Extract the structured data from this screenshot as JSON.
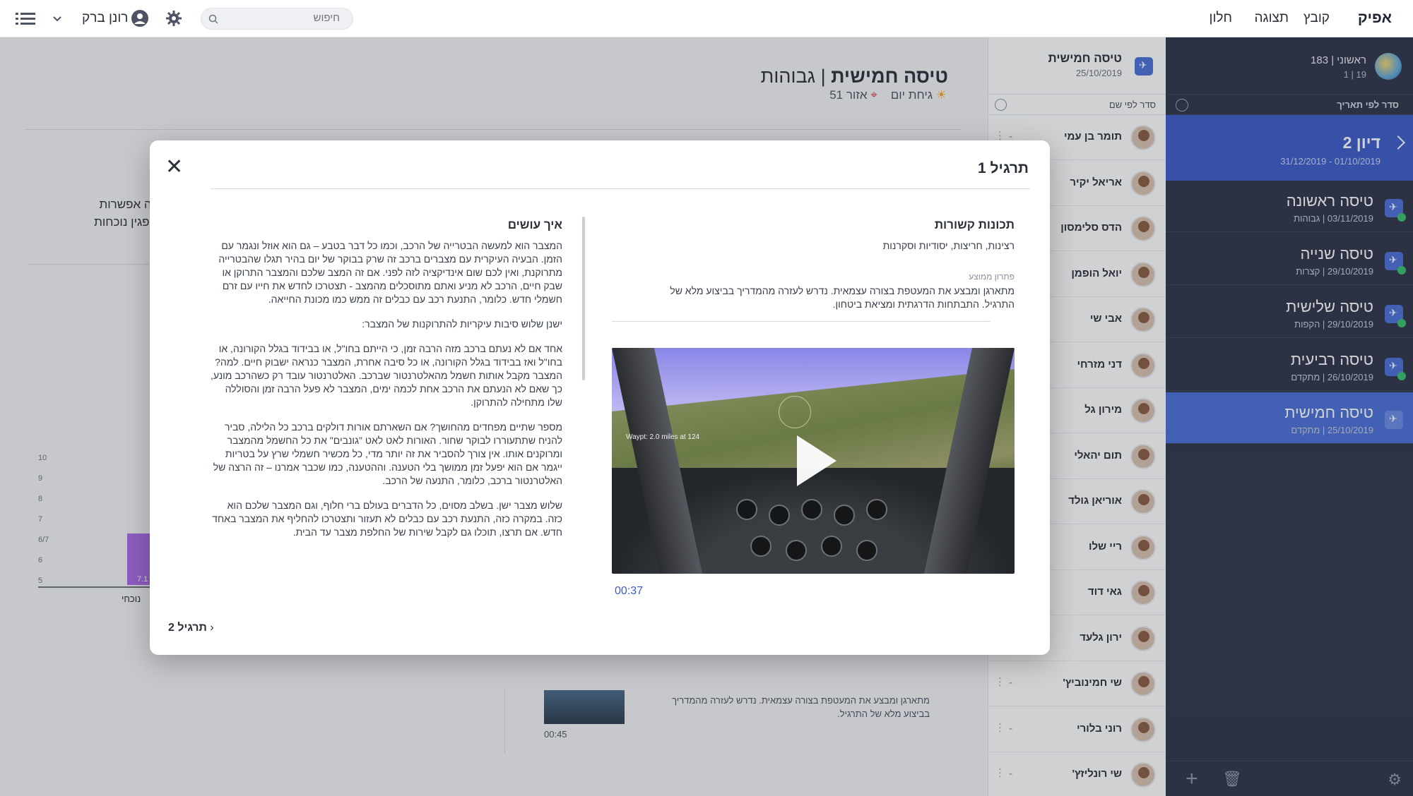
{
  "topbar": {
    "brand": "אפיק",
    "menu": [
      "קובץ",
      "תצוגה",
      "חלון"
    ],
    "search_placeholder": "חיפוש",
    "user_name": "רונן ברק"
  },
  "sidebar": {
    "header_title": "ראשוני | 183",
    "header_sub": "19 | 1",
    "sort_label": "סדר לפי תאריך",
    "group": {
      "title": "דיון 2",
      "dates": "01/10/2019 - 31/12/2019"
    },
    "items": [
      {
        "title": "טיסה ראשונה",
        "sub": "03/11/2019 | גבוהות",
        "check": true
      },
      {
        "title": "טיסה שנייה",
        "sub": "29/10/2019 | קצרות",
        "check": true
      },
      {
        "title": "טיסה שלישית",
        "sub": "29/10/2019 | הקפות",
        "check": true
      },
      {
        "title": "טיסה רביעית",
        "sub": "26/10/2019 | מתקדם",
        "check": true
      },
      {
        "title": "טיסה חמישית",
        "sub": "25/10/2019 | מתקדם",
        "check": false
      }
    ]
  },
  "participants": {
    "header_title": "טיסה חמישית",
    "header_date": "25/10/2019",
    "sort_label": "סדר לפי שם",
    "list": [
      {
        "name": "תומר בן עמי",
        "dash": "-"
      },
      {
        "name": "אריאל יקיר",
        "dash": ""
      },
      {
        "name": "הדס סלימסון",
        "dash": ""
      },
      {
        "name": "יואל הופמן",
        "dash": ""
      },
      {
        "name": "אבי שי",
        "dash": ""
      },
      {
        "name": "דני מזרחי",
        "dash": ""
      },
      {
        "name": "מירון גל",
        "dash": ""
      },
      {
        "name": "תום יהאלי",
        "dash": ""
      },
      {
        "name": "אוריאן גולד",
        "dash": ""
      },
      {
        "name": "ריי שלו",
        "dash": ""
      },
      {
        "name": "גאי דוד",
        "dash": ""
      },
      {
        "name": "ירון גלעד",
        "dash": ""
      },
      {
        "name": "שי חמינוביץ'",
        "dash": "-"
      },
      {
        "name": "רוני בלורי",
        "dash": "-"
      },
      {
        "name": "שי רונליזץ'",
        "dash": "-"
      }
    ]
  },
  "main": {
    "title_bold": "טיסה חמישית",
    "title_sep": "|",
    "title_rest": "גבוהות",
    "meta_time": "גיחת יום",
    "meta_area": "אזור 51",
    "bg_text_line1": "רעות ישנה אפשרות",
    "bg_text_line2": "התניך להפגין נוכחות",
    "lower_text": "מתארגן ומבצע את המעטפת בצורה עצמאית. נדרש לעזרה מהמדריך בביצוע מלא של התרגיל.",
    "lower_time": "00:45"
  },
  "chart_data": {
    "type": "bar",
    "categories": [
      "נוכחי"
    ],
    "values": [
      7.1
    ],
    "yticks": [
      "10",
      "9",
      "8",
      "7",
      "6/7",
      "6",
      "5"
    ],
    "ylim": [
      5,
      10
    ]
  },
  "modal": {
    "title": "תרגיל 1",
    "right_section_title": "תכונות קשורות",
    "right_section_text": "רצינות, חריצות, יסודיות וסקרנות",
    "solution_label": "פתרון ממוצע",
    "solution_text": "מתארגן ומבצע את המעטפת בצורה עצמאית. נדרש לעזרה מהמדריך בביצוע מלא של התרגיל. התבתחות הדרגתית ומציאת ביטחון.",
    "left_section_title": "איך עושים",
    "left_paragraphs": [
      "המצבר הוא למעשה הבטרייה של הרכב, וכמו כל דבר בטבע – גם הוא אוזל ונגמר עם הזמן. הבעיה העיקרית עם מצברים ברכב זה שרק בבוקר של יום בהיר תגלו שהבטרייה מתרוקנת, ואין לכם שום אינדיקציה לזה לפני. אם זה המצב שלכם והמצבר התרוקן או שבק חיים, הרכב לא מניע ואתם מתוסכלים מהמצב - תצטרכו לחדש את חייו עם זרם חשמלי חדש. כלומר, התנעת רכב עם כבלים זה ממש כמו מכונת החייאה.",
      "ישנן שלוש סיבות עיקריות להתרוקנות של המצבר:",
      "אחד אם לא נעתם ברכב מזה הרבה זמן, כי הייתם בחו\"ל, או בבידוד בגלל הקורונה, או בחו\"ל ואז בבידוד בגלל הקורונה, או כל סיבה אחרת, המצבר כנראה ישבוק חיים. למה? המצבר מקבל אותות חשמל מהאלטרנטור שברכב. האלטרנטור עובד רק כשהרכב מונע, כך שאם לא הנעתם את הרכב אחת לכמה ימים, המצבר לא פעל הרבה זמן והסוללה שלו מתחילה להתרוקן.",
      "מספר שתיים מפחדים מהחושך? אם השארתם אורות דולקים ברכב כל הלילה, סביר להניח שתתעוררו לבוקר שחור. האורות לאט לאט \"גונבים\" את כל החשמל מהמצבר ומרוקנים אותו. אין צורך להסביר את זה יותר מדי, כל מכשיר חשמלי שרץ על בטריות ייגמר אם הוא יפעל זמן ממושך בלי הטענה. וההטענה, כמו שכבר אמרנו – זה הרצה של האלטרנטור ברכב, כלומר, התנעה של הרכב.",
      "שלוש מצבר ישן. בשלב מסוים, כל הדברים בעולם ברי חלוף, וגם המצבר שלכם הוא כזה. במקרה כזה, התנעת רכב עם כבלים לא תעזור ותצטרכו להחליף את המצבר באחד חדש. אם תרצו, תוכלו גם לקבל שירות של החלפת מצבר עד הבית."
    ],
    "video_overlay": "Waypt: 2.0 miles at 124",
    "video_time": "00:37",
    "next_label": "תרגיל 2"
  }
}
